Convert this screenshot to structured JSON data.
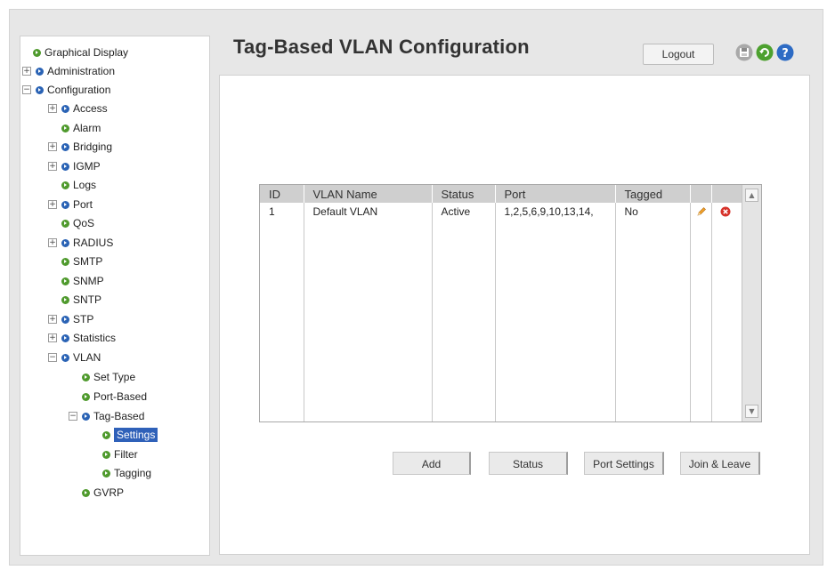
{
  "app": {
    "title": "Tag-Based VLAN Configuration"
  },
  "header": {
    "logout_label": "Logout",
    "icons": [
      "save-icon",
      "refresh-icon",
      "help-icon"
    ]
  },
  "sidebar": {
    "items": [
      {
        "label": "Graphical Display",
        "toggle": "",
        "bullet": "green"
      },
      {
        "label": "Administration",
        "toggle": "+",
        "bullet": "blue"
      },
      {
        "label": "Configuration",
        "toggle": "−",
        "bullet": "blue"
      },
      {
        "label": "Access",
        "toggle": "+",
        "bullet": "blue"
      },
      {
        "label": "Alarm",
        "toggle": "",
        "bullet": "green"
      },
      {
        "label": "Bridging",
        "toggle": "+",
        "bullet": "blue"
      },
      {
        "label": "IGMP",
        "toggle": "+",
        "bullet": "blue"
      },
      {
        "label": "Logs",
        "toggle": "",
        "bullet": "green"
      },
      {
        "label": "Port",
        "toggle": "+",
        "bullet": "blue"
      },
      {
        "label": "QoS",
        "toggle": "",
        "bullet": "green"
      },
      {
        "label": "RADIUS",
        "toggle": "+",
        "bullet": "blue"
      },
      {
        "label": "SMTP",
        "toggle": "",
        "bullet": "green"
      },
      {
        "label": "SNMP",
        "toggle": "",
        "bullet": "green"
      },
      {
        "label": "SNTP",
        "toggle": "",
        "bullet": "green"
      },
      {
        "label": "STP",
        "toggle": "+",
        "bullet": "blue"
      },
      {
        "label": "Statistics",
        "toggle": "+",
        "bullet": "blue"
      },
      {
        "label": "VLAN",
        "toggle": "−",
        "bullet": "blue"
      },
      {
        "label": "Set Type",
        "toggle": "",
        "bullet": "green"
      },
      {
        "label": "Port-Based",
        "toggle": "",
        "bullet": "green"
      },
      {
        "label": "Tag-Based",
        "toggle": "−",
        "bullet": "blue"
      },
      {
        "label": "Settings",
        "toggle": "",
        "bullet": "green",
        "selected": true
      },
      {
        "label": "Filter",
        "toggle": "",
        "bullet": "green"
      },
      {
        "label": "Tagging",
        "toggle": "",
        "bullet": "green"
      },
      {
        "label": "GVRP",
        "toggle": "",
        "bullet": "green"
      }
    ]
  },
  "table": {
    "headers": [
      "ID",
      "VLAN Name",
      "Status",
      "Port",
      "Tagged",
      "",
      ""
    ],
    "rows": [
      {
        "id": "1",
        "name": "Default VLAN",
        "status": "Active",
        "port": "1,2,5,6,9,10,13,14,",
        "tagged": "No",
        "edit_icon": "pencil-icon",
        "delete_icon": "delete-icon"
      }
    ]
  },
  "actions": {
    "add": "Add",
    "status": "Status",
    "port_settings": "Port Settings",
    "join_leave": "Join & Leave"
  },
  "colors": {
    "selected_bg": "#2f61b9",
    "bullet_blue": "#2a63b5",
    "bullet_green": "#4f9a2d",
    "delete_red": "#d6322a"
  }
}
